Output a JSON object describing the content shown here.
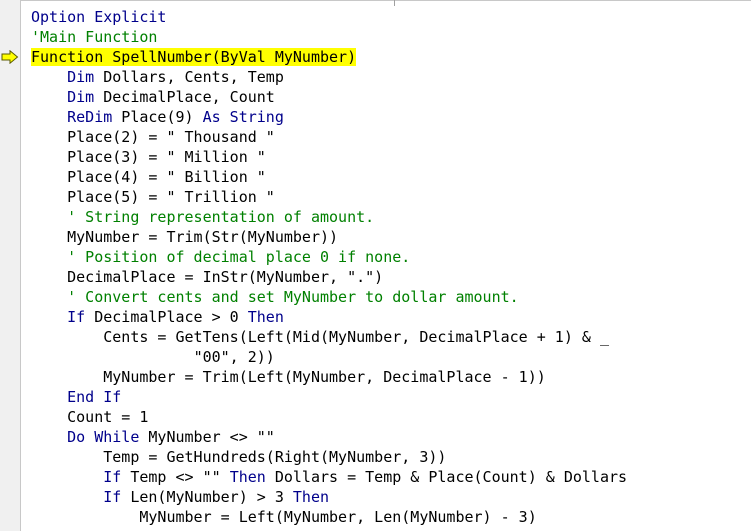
{
  "colors": {
    "keyword": "#00008B",
    "comment": "#008000",
    "text": "#000000",
    "execution_highlight": "#FFFF00",
    "execution_arrow": "#FFFF00"
  },
  "margin": {
    "indicator_icon": "execution-point-arrow-icon",
    "indicator_line": 3
  },
  "code": {
    "lines": [
      {
        "indent": "",
        "tokens": [
          {
            "t": "kw",
            "v": "Option Explicit"
          }
        ]
      },
      {
        "indent": "",
        "tokens": [
          {
            "t": "cm",
            "v": "'Main Function"
          }
        ]
      },
      {
        "indent": "",
        "highlight": true,
        "tokens": [
          {
            "t": "tx",
            "v": "Function SpellNumber(ByVal MyNumber)"
          }
        ]
      },
      {
        "indent": "    ",
        "tokens": [
          {
            "t": "kw",
            "v": "Dim"
          },
          {
            "t": "tx",
            "v": " Dollars, Cents, Temp"
          }
        ]
      },
      {
        "indent": "    ",
        "tokens": [
          {
            "t": "kw",
            "v": "Dim"
          },
          {
            "t": "tx",
            "v": " DecimalPlace, Count"
          }
        ]
      },
      {
        "indent": "    ",
        "tokens": [
          {
            "t": "kw",
            "v": "ReDim"
          },
          {
            "t": "tx",
            "v": " Place(9) "
          },
          {
            "t": "kw",
            "v": "As String"
          }
        ]
      },
      {
        "indent": "    ",
        "tokens": [
          {
            "t": "tx",
            "v": "Place(2) = \" Thousand \""
          }
        ]
      },
      {
        "indent": "    ",
        "tokens": [
          {
            "t": "tx",
            "v": "Place(3) = \" Million \""
          }
        ]
      },
      {
        "indent": "    ",
        "tokens": [
          {
            "t": "tx",
            "v": "Place(4) = \" Billion \""
          }
        ]
      },
      {
        "indent": "    ",
        "tokens": [
          {
            "t": "tx",
            "v": "Place(5) = \" Trillion \""
          }
        ]
      },
      {
        "indent": "    ",
        "tokens": [
          {
            "t": "cm",
            "v": "' String representation of amount."
          }
        ]
      },
      {
        "indent": "    ",
        "tokens": [
          {
            "t": "tx",
            "v": "MyNumber = Trim(Str(MyNumber))"
          }
        ]
      },
      {
        "indent": "    ",
        "tokens": [
          {
            "t": "cm",
            "v": "' Position of decimal place 0 if none."
          }
        ]
      },
      {
        "indent": "    ",
        "tokens": [
          {
            "t": "tx",
            "v": "DecimalPlace = InStr(MyNumber, \".\")"
          }
        ]
      },
      {
        "indent": "    ",
        "tokens": [
          {
            "t": "cm",
            "v": "' Convert cents and set MyNumber to dollar amount."
          }
        ]
      },
      {
        "indent": "    ",
        "tokens": [
          {
            "t": "kw",
            "v": "If"
          },
          {
            "t": "tx",
            "v": " DecimalPlace > 0 "
          },
          {
            "t": "kw",
            "v": "Then"
          }
        ]
      },
      {
        "indent": "        ",
        "tokens": [
          {
            "t": "tx",
            "v": "Cents = GetTens(Left(Mid(MyNumber, DecimalPlace + 1) & _"
          }
        ]
      },
      {
        "indent": "                  ",
        "tokens": [
          {
            "t": "tx",
            "v": "\"00\", 2))"
          }
        ]
      },
      {
        "indent": "        ",
        "tokens": [
          {
            "t": "tx",
            "v": "MyNumber = Trim(Left(MyNumber, DecimalPlace - 1))"
          }
        ]
      },
      {
        "indent": "    ",
        "tokens": [
          {
            "t": "kw",
            "v": "End If"
          }
        ]
      },
      {
        "indent": "    ",
        "tokens": [
          {
            "t": "tx",
            "v": "Count = 1"
          }
        ]
      },
      {
        "indent": "    ",
        "tokens": [
          {
            "t": "kw",
            "v": "Do While"
          },
          {
            "t": "tx",
            "v": " MyNumber <> \"\""
          }
        ]
      },
      {
        "indent": "        ",
        "tokens": [
          {
            "t": "tx",
            "v": "Temp = GetHundreds(Right(MyNumber, 3))"
          }
        ]
      },
      {
        "indent": "        ",
        "tokens": [
          {
            "t": "kw",
            "v": "If"
          },
          {
            "t": "tx",
            "v": " Temp <> \"\" "
          },
          {
            "t": "kw",
            "v": "Then"
          },
          {
            "t": "tx",
            "v": " Dollars = Temp & Place(Count) & Dollars"
          }
        ]
      },
      {
        "indent": "        ",
        "tokens": [
          {
            "t": "kw",
            "v": "If"
          },
          {
            "t": "tx",
            "v": " Len(MyNumber) > 3 "
          },
          {
            "t": "kw",
            "v": "Then"
          }
        ]
      },
      {
        "indent": "            ",
        "tokens": [
          {
            "t": "tx",
            "v": "MyNumber = Left(MyNumber, Len(MyNumber) - 3)"
          }
        ]
      }
    ]
  }
}
